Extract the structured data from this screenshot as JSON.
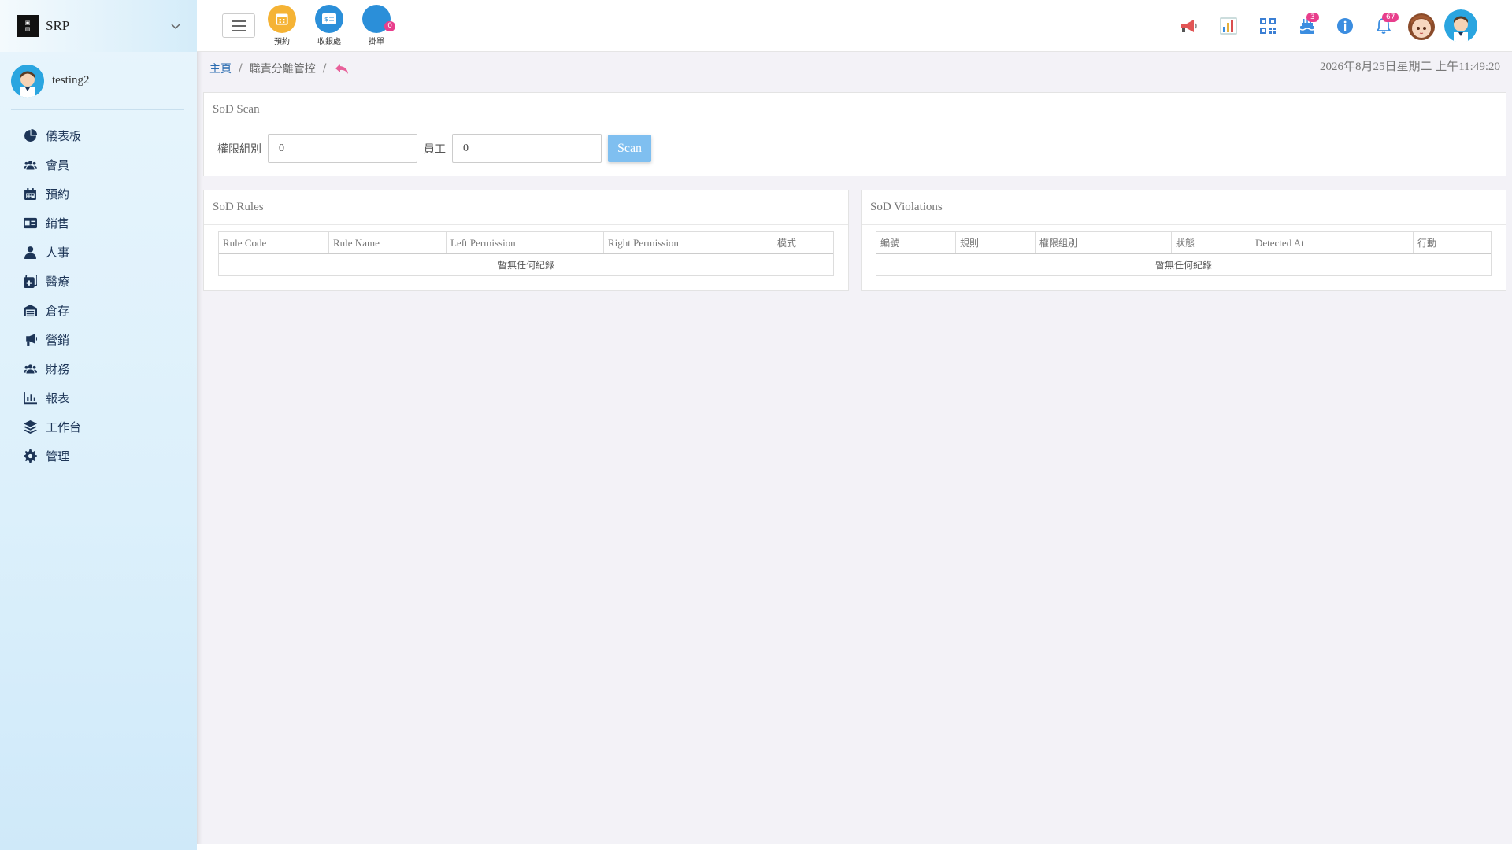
{
  "sidebar": {
    "brand_name": "SRP",
    "user_name": "testing2",
    "items": [
      {
        "label": "儀表板",
        "icon": "pie-chart-icon"
      },
      {
        "label": "會員",
        "icon": "users-icon"
      },
      {
        "label": "預約",
        "icon": "calendar-icon"
      },
      {
        "label": "銷售",
        "icon": "id-card-icon"
      },
      {
        "label": "人事",
        "icon": "user-icon"
      },
      {
        "label": "醫療",
        "icon": "medical-icon"
      },
      {
        "label": "倉存",
        "icon": "warehouse-icon"
      },
      {
        "label": "營銷",
        "icon": "megaphone-icon"
      },
      {
        "label": "財務",
        "icon": "users-icon"
      },
      {
        "label": "報表",
        "icon": "bar-chart-icon"
      },
      {
        "label": "工作台",
        "icon": "layers-icon"
      },
      {
        "label": "管理",
        "icon": "gear-icon"
      }
    ]
  },
  "topbar": {
    "quick": [
      {
        "label": "預約",
        "color": "#f5b335",
        "icon": "calendar-icon"
      },
      {
        "label": "收銀處",
        "color": "#2b8fd9",
        "icon": "cashier-icon"
      },
      {
        "label": "掛單",
        "color": "#2b8fd9",
        "icon": "pending-order-icon",
        "badge": "0"
      }
    ],
    "birthday_badge": "3",
    "notification_badge": "67"
  },
  "breadcrumb": {
    "home": "主頁",
    "sep": "/",
    "current": "職責分離管控"
  },
  "datetime": "2026年8月25日星期二 上午11:49:20",
  "scan": {
    "title": "SoD Scan",
    "group_label": "權限組別",
    "group_value": "0",
    "staff_label": "員工",
    "staff_value": "0",
    "button": "Scan"
  },
  "rules": {
    "title": "SoD Rules",
    "columns": [
      "Rule Code",
      "Rule Name",
      "Left Permission",
      "Right Permission",
      "模式"
    ],
    "empty": "暫無任何紀錄"
  },
  "violations": {
    "title": "SoD Violations",
    "columns": [
      "編號",
      "規則",
      "權限組別",
      "狀態",
      "Detected At",
      "行動"
    ],
    "empty": "暫無任何紀錄"
  }
}
